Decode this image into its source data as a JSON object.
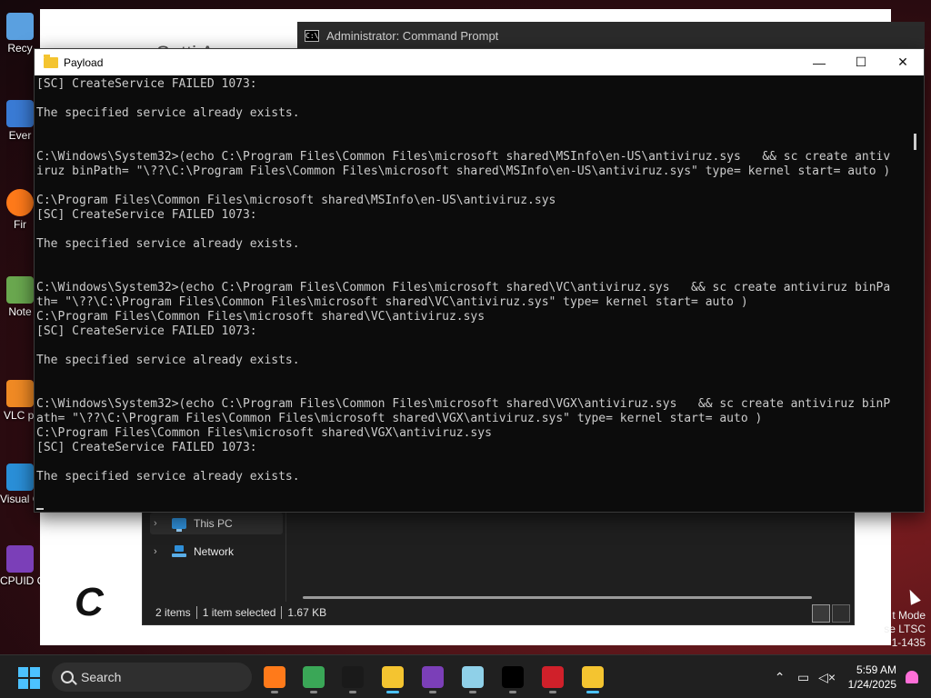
{
  "desktop": {
    "icons": [
      {
        "label": "Recy",
        "color": "#5aa0e0"
      },
      {
        "label": "Ever",
        "color": "#3a7bd5"
      },
      {
        "label": "Fir",
        "color": "#ff7a1a"
      },
      {
        "label": "Note",
        "color": "#6aa84f"
      },
      {
        "label": "VLC pl",
        "color": "#f08a24"
      },
      {
        "label": "Visual Co",
        "color": "#2a8fd8"
      },
      {
        "label": "CPUID C",
        "color": "#7b3fb8"
      }
    ]
  },
  "background_window": {
    "ghost_title": "Setti    A"
  },
  "cmd_background": {
    "icon_text": "C:\\",
    "title": "Administrator: Command Prompt"
  },
  "payload_window": {
    "title": "Payload",
    "buttons": {
      "minimize": "—",
      "maximize": "☐",
      "close": "✕"
    },
    "console_lines": [
      "[SC] CreateService FAILED 1073:",
      "",
      "The specified service already exists.",
      "",
      "",
      "C:\\Windows\\System32>(echo C:\\Program Files\\Common Files\\microsoft shared\\MSInfo\\en-US\\antiviruz.sys   && sc create antiv",
      "iruz binPath= \"\\??\\C:\\Program Files\\Common Files\\microsoft shared\\MSInfo\\en-US\\antiviruz.sys\" type= kernel start= auto )",
      "",
      "C:\\Program Files\\Common Files\\microsoft shared\\MSInfo\\en-US\\antiviruz.sys",
      "[SC] CreateService FAILED 1073:",
      "",
      "The specified service already exists.",
      "",
      "",
      "C:\\Windows\\System32>(echo C:\\Program Files\\Common Files\\microsoft shared\\VC\\antiviruz.sys   && sc create antiviruz binPa",
      "th= \"\\??\\C:\\Program Files\\Common Files\\microsoft shared\\VC\\antiviruz.sys\" type= kernel start= auto )",
      "C:\\Program Files\\Common Files\\microsoft shared\\VC\\antiviruz.sys",
      "[SC] CreateService FAILED 1073:",
      "",
      "The specified service already exists.",
      "",
      "",
      "C:\\Windows\\System32>(echo C:\\Program Files\\Common Files\\microsoft shared\\VGX\\antiviruz.sys   && sc create antiviruz binP",
      "ath= \"\\??\\C:\\Program Files\\Common Files\\microsoft shared\\VGX\\antiviruz.sys\" type= kernel start= auto )",
      "C:\\Program Files\\Common Files\\microsoft shared\\VGX\\antiviruz.sys",
      "[SC] CreateService FAILED 1073:",
      "",
      "The specified service already exists."
    ]
  },
  "explorer": {
    "nav": [
      {
        "label": "This PC",
        "icon": "pc-icon",
        "selected": true
      },
      {
        "label": "Network",
        "icon": "network-icon",
        "selected": false
      }
    ],
    "status": {
      "items": "2 items",
      "selected": "1 item selected",
      "size": "1.67 KB"
    }
  },
  "ccleaner_logo": "C",
  "watermark": {
    "line1": "t Mode",
    "line2": "se LTSC",
    "line3": "1-1435"
  },
  "taskbar": {
    "search_label": "Search",
    "apps": [
      {
        "name": "firefox",
        "color": "#ff7a1a",
        "active": false
      },
      {
        "name": "chrome-like",
        "color": "#3aa757",
        "active": false
      },
      {
        "name": "terminal",
        "color": "#1a1a1a",
        "active": false
      },
      {
        "name": "file-explorer",
        "color": "#f4c430",
        "active": true
      },
      {
        "name": "cpuid",
        "color": "#7b3fb8",
        "active": false
      },
      {
        "name": "notepad",
        "color": "#8fd0e8",
        "active": false
      },
      {
        "name": "7zip",
        "color": "#000000",
        "active": false
      },
      {
        "name": "ccleaner",
        "color": "#d0202a",
        "active": false
      },
      {
        "name": "payload-folder",
        "color": "#f4c430",
        "active": true
      }
    ],
    "clock": {
      "time": "5:59 AM",
      "date": "1/24/2025"
    },
    "tray_icons": [
      "chevron-up-icon",
      "network-icon",
      "volume-muted-icon"
    ]
  }
}
